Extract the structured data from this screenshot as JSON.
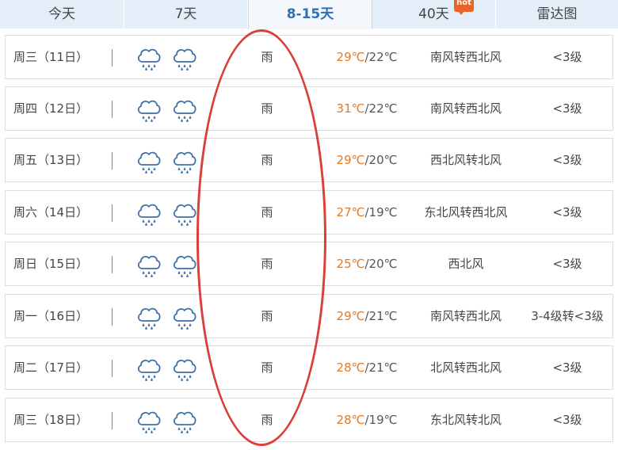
{
  "tabs": [
    {
      "label": "今天",
      "active": false
    },
    {
      "label": "7天",
      "active": false
    },
    {
      "label": "8-15天",
      "active": true
    },
    {
      "label": "40天",
      "active": false,
      "badge": "hot"
    },
    {
      "label": "雷达图",
      "active": false
    }
  ],
  "days": [
    {
      "day": "周三（11日）",
      "icon": "rain-cloud-icon",
      "weather": "雨",
      "high": "29℃",
      "low": "/22℃",
      "wind": "南风转西北风",
      "level": "<3级"
    },
    {
      "day": "周四（12日）",
      "icon": "rain-cloud-icon",
      "weather": "雨",
      "high": "31℃",
      "low": "/22℃",
      "wind": "南风转西北风",
      "level": "<3级"
    },
    {
      "day": "周五（13日）",
      "icon": "rain-cloud-icon",
      "weather": "雨",
      "high": "29℃",
      "low": "/20℃",
      "wind": "西北风转北风",
      "level": "<3级"
    },
    {
      "day": "周六（14日）",
      "icon": "rain-cloud-icon",
      "weather": "雨",
      "high": "27℃",
      "low": "/19℃",
      "wind": "东北风转西北风",
      "level": "<3级"
    },
    {
      "day": "周日（15日）",
      "icon": "rain-cloud-icon",
      "weather": "雨",
      "high": "25℃",
      "low": "/20℃",
      "wind": "西北风",
      "level": "<3级"
    },
    {
      "day": "周一（16日）",
      "icon": "rain-cloud-icon",
      "weather": "雨",
      "high": "29℃",
      "low": "/21℃",
      "wind": "南风转西北风",
      "level": "3-4级转<3级"
    },
    {
      "day": "周二（17日）",
      "icon": "rain-cloud-icon",
      "weather": "雨",
      "high": "28℃",
      "low": "/21℃",
      "wind": "北风转西北风",
      "level": "<3级"
    },
    {
      "day": "周三（18日）",
      "icon": "rain-cloud-icon",
      "weather": "雨",
      "high": "28℃",
      "low": "/19℃",
      "wind": "东北风转北风",
      "level": "<3级"
    }
  ],
  "colors": {
    "tab_bar": "#e4eef8",
    "active_tab_text": "#2f6fb6",
    "high_temp": "#e6781e",
    "annotation_circle": "#d9403a",
    "hot_badge": "#e8642a"
  }
}
